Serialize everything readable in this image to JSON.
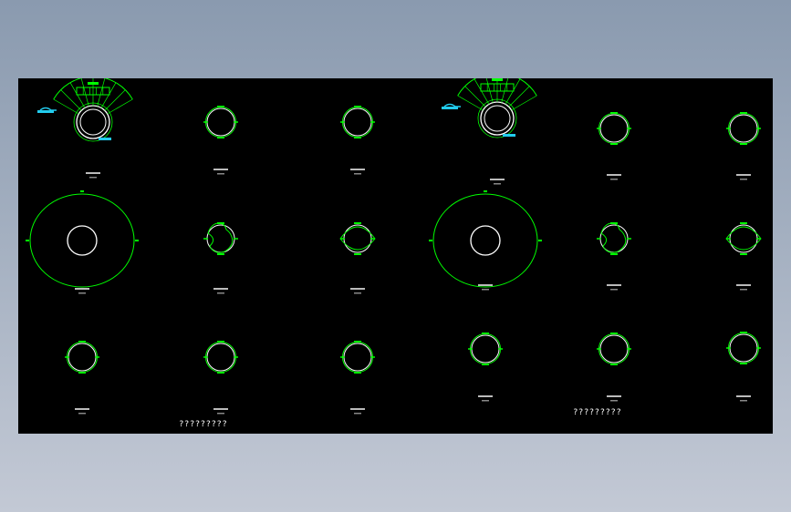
{
  "drawing": {
    "background": "#000000",
    "line_color": "#00ff00",
    "outline_color": "#ffffff",
    "accent_color": "#22ccee",
    "footnotes": [
      "?????????",
      "?????????"
    ],
    "panels": [
      {
        "kind": "fan",
        "caption": "",
        "subcaption": ""
      },
      {
        "kind": "ring",
        "caption": "",
        "subcaption": ""
      },
      {
        "kind": "ring",
        "caption": "",
        "subcaption": ""
      },
      {
        "kind": "fan",
        "caption": "",
        "subcaption": ""
      },
      {
        "kind": "ring",
        "caption": "",
        "subcaption": ""
      },
      {
        "kind": "ring",
        "caption": "",
        "subcaption": ""
      },
      {
        "kind": "large-ring",
        "caption": "",
        "subcaption": ""
      },
      {
        "kind": "irregular",
        "caption": "",
        "subcaption": ""
      },
      {
        "kind": "lens",
        "caption": "",
        "subcaption": ""
      },
      {
        "kind": "large-ring",
        "caption": "",
        "subcaption": ""
      },
      {
        "kind": "irregular",
        "caption": "",
        "subcaption": ""
      },
      {
        "kind": "lens",
        "caption": "",
        "subcaption": ""
      },
      {
        "kind": "ring",
        "caption": "",
        "subcaption": ""
      },
      {
        "kind": "ring",
        "caption": "",
        "subcaption": ""
      },
      {
        "kind": "ring",
        "caption": "",
        "subcaption": ""
      },
      {
        "kind": "ring",
        "caption": "",
        "subcaption": ""
      },
      {
        "kind": "ring",
        "caption": "",
        "subcaption": ""
      },
      {
        "kind": "ring",
        "caption": "",
        "subcaption": ""
      }
    ]
  }
}
